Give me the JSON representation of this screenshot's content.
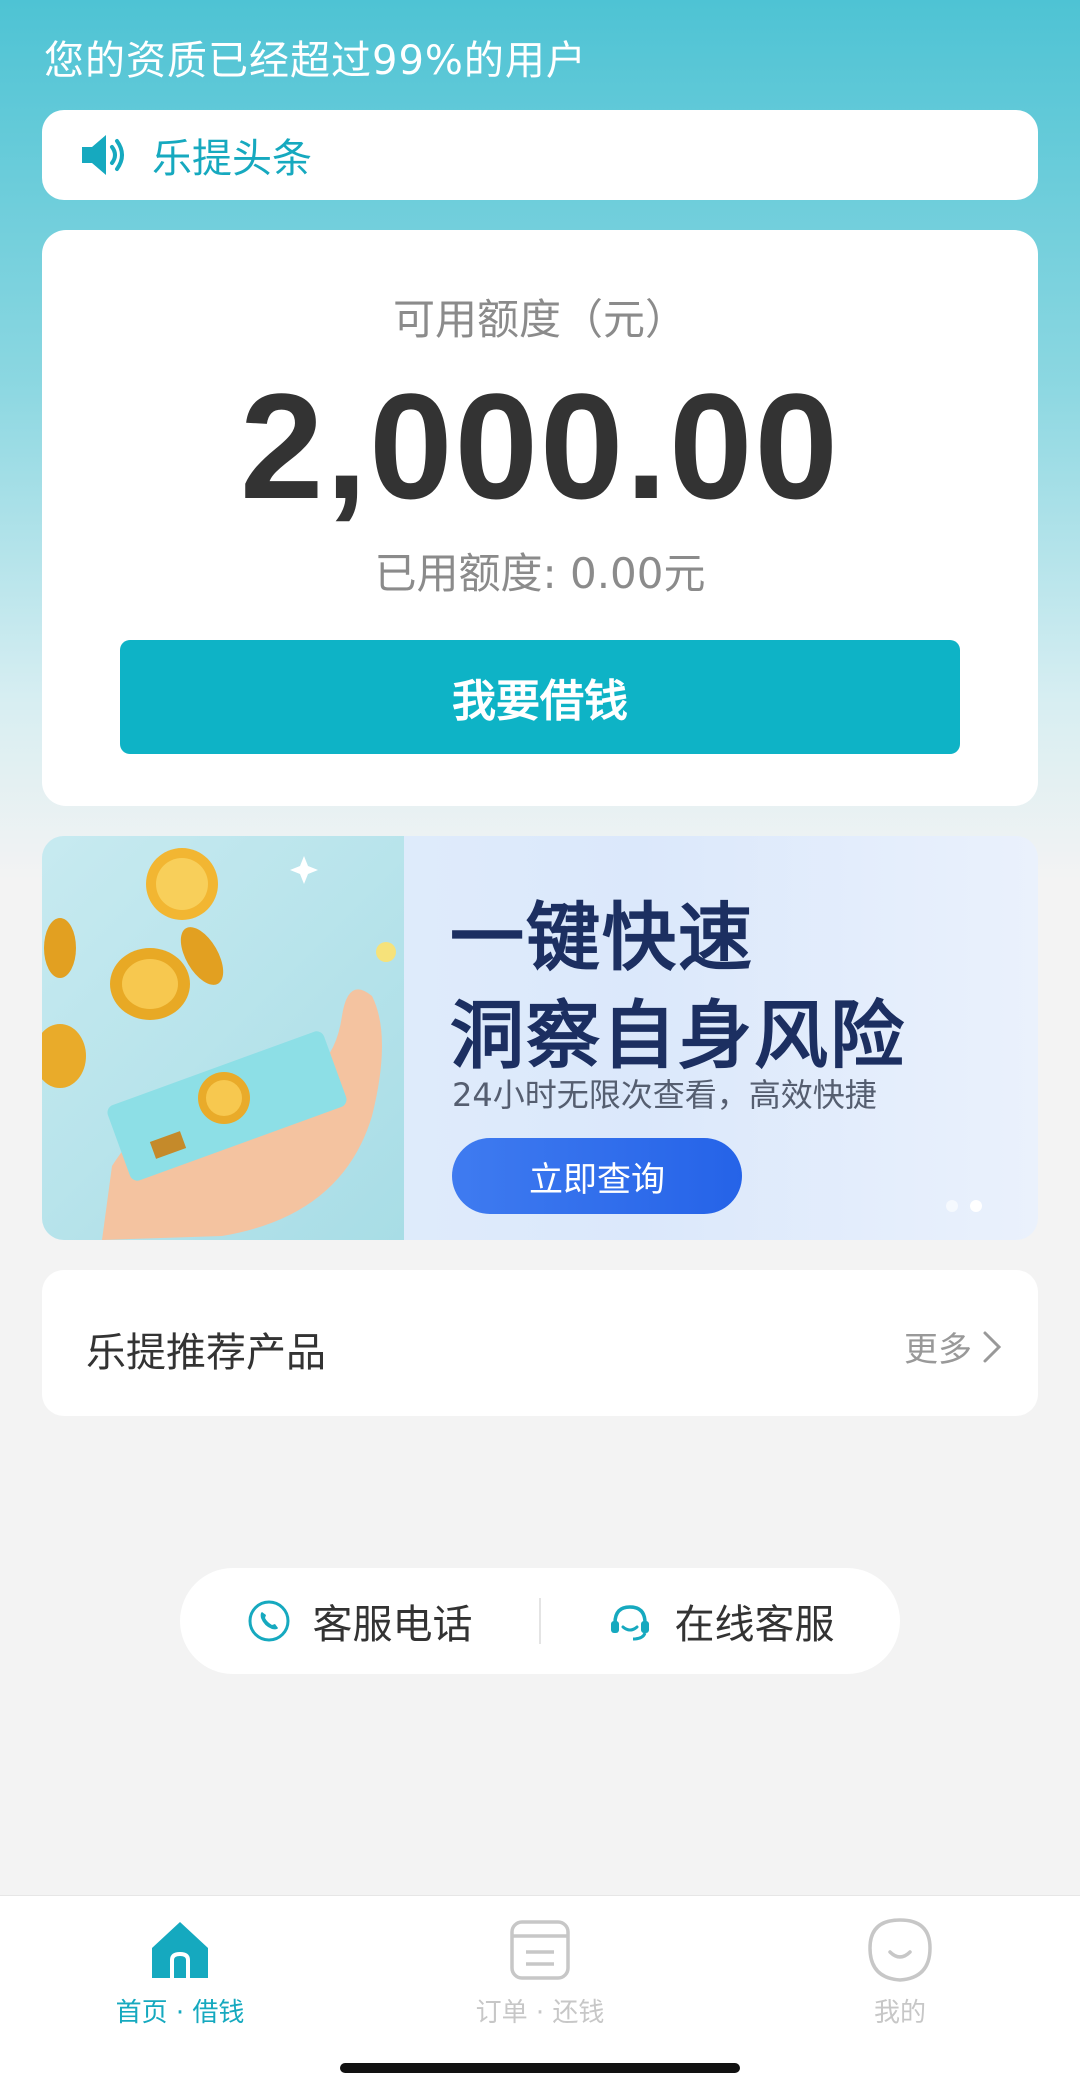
{
  "header": {
    "qualification_text": "您的资质已经超过99%的用户"
  },
  "news": {
    "label": "乐提头条",
    "icon": "speaker-icon"
  },
  "credit": {
    "title": "可用额度（元）",
    "amount": "2,000.00",
    "used_label": "已用额度: 0.00元",
    "borrow_button": "我要借钱"
  },
  "banner": {
    "headline_line1": "一键快速",
    "headline_line2": "洞察自身风险",
    "subtitle": "24小时无限次查看，高效快捷",
    "button": "立即查询",
    "slide_count": 2,
    "active_slide": 2
  },
  "recommend": {
    "title": "乐提推荐产品",
    "more": "更多"
  },
  "service": {
    "phone_label": "客服电话",
    "online_label": "在线客服"
  },
  "tabs": [
    {
      "label": "首页 · 借钱",
      "icon": "home-icon",
      "active": true
    },
    {
      "label": "订单 · 还钱",
      "icon": "order-icon",
      "active": false
    },
    {
      "label": "我的",
      "icon": "profile-icon",
      "active": false
    }
  ],
  "colors": {
    "accent": "#0eb3c6",
    "header_gradient_top": "#4ec3d4",
    "banner_button": "#2563e8",
    "headline": "#1c2f61"
  }
}
